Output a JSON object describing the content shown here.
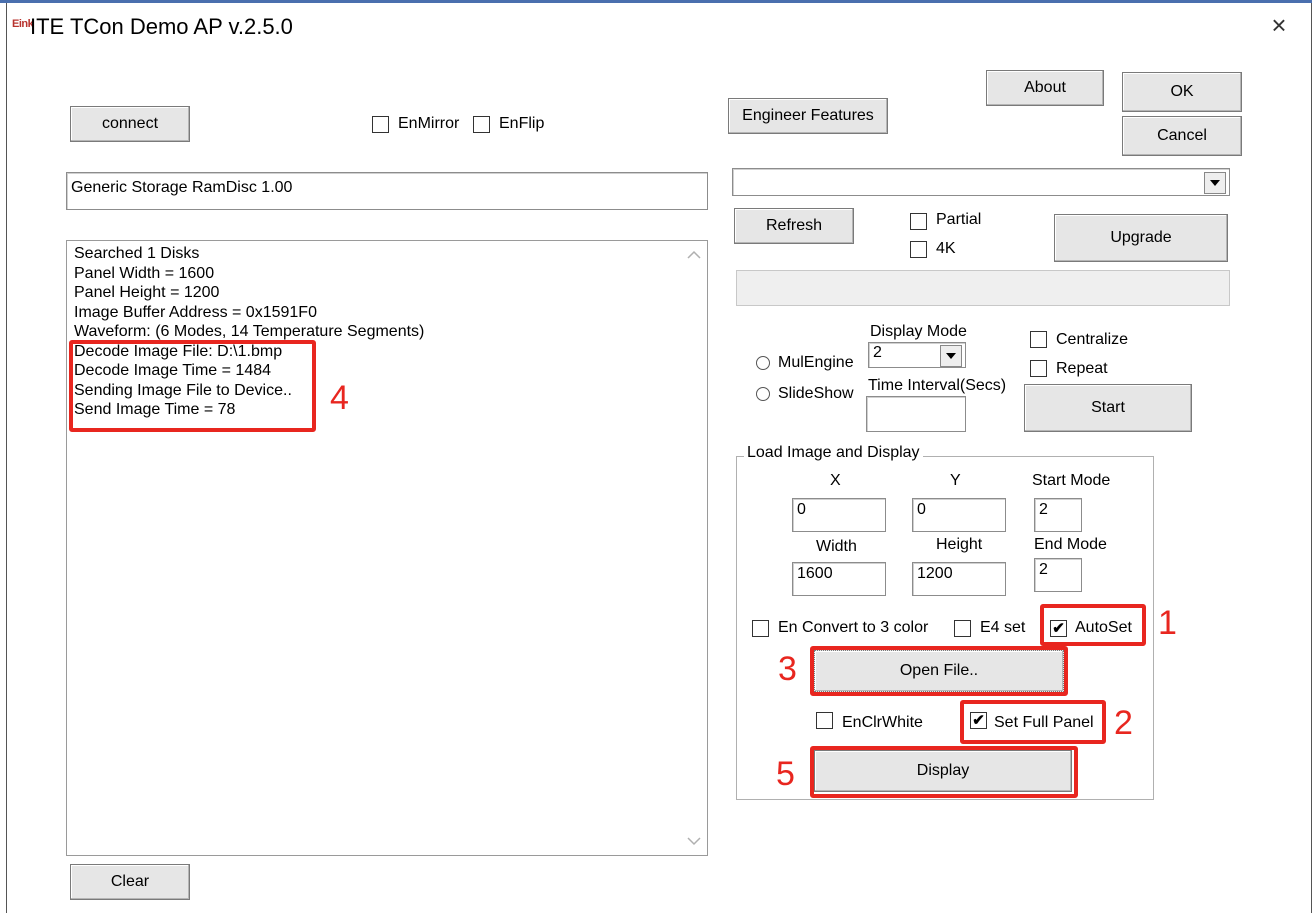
{
  "window": {
    "title": "ITE TCon Demo AP v.2.5.0",
    "logo_text": "Eink",
    "close_glyph": "×",
    "accent_color": "#4a6fae"
  },
  "buttons": {
    "connect": "connect",
    "engineer": "Engineer Features",
    "about": "About",
    "ok": "OK",
    "cancel": "Cancel",
    "refresh": "Refresh",
    "upgrade": "Upgrade",
    "start": "Start",
    "open_file": "Open File..",
    "display": "Display",
    "clear": "Clear"
  },
  "checkboxes": {
    "en_mirror": {
      "label": "EnMirror",
      "checked": false
    },
    "en_flip": {
      "label": "EnFlip",
      "checked": false
    },
    "partial": {
      "label": "Partial",
      "checked": false
    },
    "fourk": {
      "label": "4K",
      "checked": false
    },
    "centralize": {
      "label": "Centralize",
      "checked": false
    },
    "repeat": {
      "label": "Repeat",
      "checked": false
    },
    "en_convert": {
      "label": "En Convert to 3 color",
      "checked": false
    },
    "e4_set": {
      "label": "E4 set",
      "checked": false
    },
    "autoset": {
      "label": "AutoSet",
      "checked": true,
      "mark": "✔"
    },
    "en_clr_white": {
      "label": "EnClrWhite",
      "checked": false
    },
    "set_full_panel": {
      "label": "Set Full Panel",
      "checked": true,
      "mark": "✔"
    }
  },
  "device_field": {
    "value": "Generic Storage RamDisc 1.00"
  },
  "device_dropdown": {
    "value": ""
  },
  "radios": {
    "mul_engine": "MulEngine",
    "slideshow": "SlideShow"
  },
  "display_mode": {
    "label": "Display Mode",
    "value": "2",
    "time_interval_label": "Time Interval(Secs)",
    "time_interval_value": ""
  },
  "load_image": {
    "group_title": "Load Image and Display",
    "x_label": "X",
    "x_value": "0",
    "y_label": "Y",
    "y_value": "0",
    "start_mode_label": "Start Mode",
    "start_mode_value": "2",
    "width_label": "Width",
    "width_value": "1600",
    "height_label": "Height",
    "height_value": "1200",
    "end_mode_label": "End Mode",
    "end_mode_value": "2"
  },
  "log": {
    "lines": [
      "Searched 1 Disks",
      "Panel Width = 1600",
      "Panel Height = 1200",
      "Image Buffer Address = 0x1591F0",
      "Waveform: (6 Modes, 14 Temperature Segments)",
      "Decode Image File: D:\\1.bmp",
      "Decode Image Time = 1484",
      "Sending Image File to Device..",
      "Send Image Time = 78"
    ]
  },
  "annotations": {
    "color": "#e8261f",
    "n1": "1",
    "n2": "2",
    "n3": "3",
    "n4": "4",
    "n5": "5"
  }
}
